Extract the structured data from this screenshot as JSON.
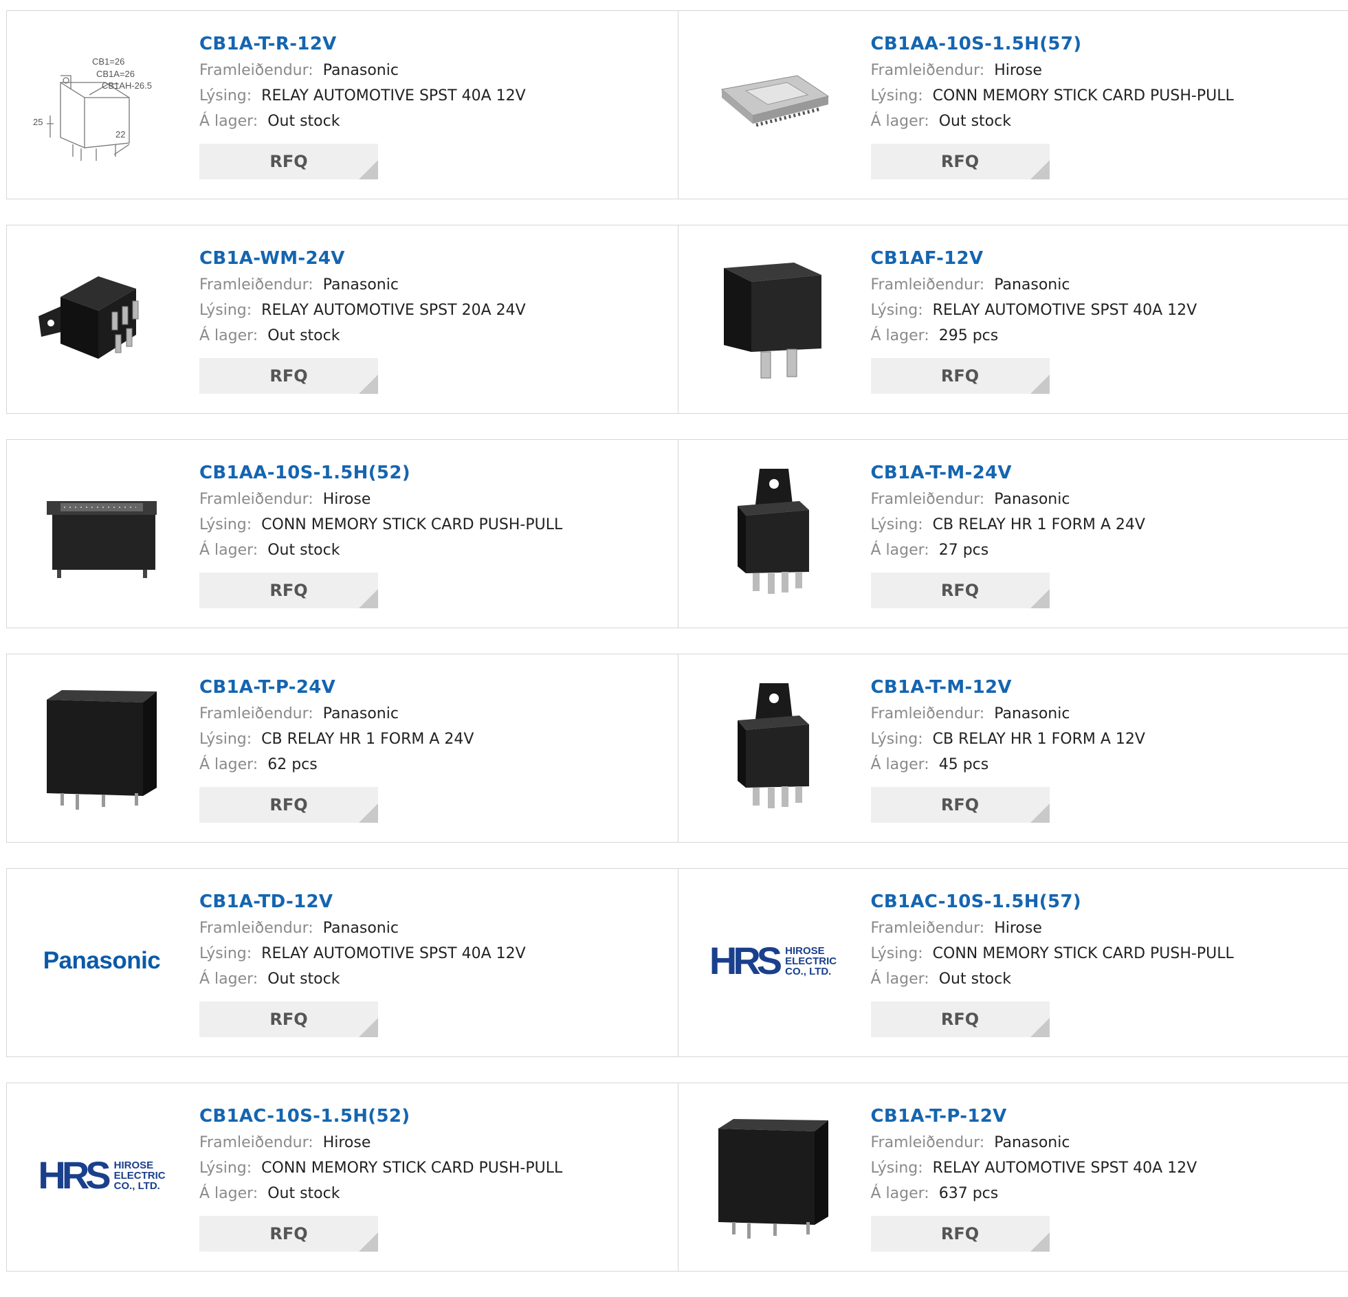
{
  "labels": {
    "manufacturer": "Framleiðendur:",
    "description": "Lýsing:",
    "stock": "Á lager:",
    "rfq": "RFQ"
  },
  "colors": {
    "title": "#1565b0",
    "border": "#d6d6d6",
    "button_bg": "#efefef"
  },
  "products": [
    {
      "part": "CB1A-T-R-12V",
      "manufacturer": "Panasonic",
      "description": "RELAY AUTOMOTIVE SPST 40A 12V",
      "stock": "Out stock",
      "image": "relay-dimension-drawing",
      "drawing_labels": [
        "CB1=26",
        "CB1A=26",
        "CB1AH-26.5",
        "25",
        "22"
      ]
    },
    {
      "part": "CB1AA-10S-1.5H(57)",
      "manufacturer": "Hirose",
      "description": "CONN MEMORY STICK CARD PUSH-PULL",
      "stock": "Out stock",
      "image": "card-connector"
    },
    {
      "part": "CB1A-WM-24V",
      "manufacturer": "Panasonic",
      "description": "RELAY AUTOMOTIVE SPST 20A 24V",
      "stock": "Out stock",
      "image": "relay-flange"
    },
    {
      "part": "CB1AF-12V",
      "manufacturer": "Panasonic",
      "description": "RELAY AUTOMOTIVE SPST 40A 12V",
      "stock": "295 pcs",
      "image": "relay-tall"
    },
    {
      "part": "CB1AA-10S-1.5H(52)",
      "manufacturer": "Hirose",
      "description": "CONN MEMORY STICK CARD PUSH-PULL",
      "stock": "Out stock",
      "image": "card-connector-dark"
    },
    {
      "part": "CB1A-T-M-24V",
      "manufacturer": "Panasonic",
      "description": "CB RELAY HR 1 FORM A 24V",
      "stock": "27 pcs",
      "image": "relay-bracket"
    },
    {
      "part": "CB1A-T-P-24V",
      "manufacturer": "Panasonic",
      "description": "CB RELAY HR 1 FORM A 24V",
      "stock": "62 pcs",
      "image": "relay-pcb"
    },
    {
      "part": "CB1A-T-M-12V",
      "manufacturer": "Panasonic",
      "description": "CB RELAY HR 1 FORM A 12V",
      "stock": "45 pcs",
      "image": "relay-bracket"
    },
    {
      "part": "CB1A-TD-12V",
      "manufacturer": "Panasonic",
      "description": "RELAY AUTOMOTIVE SPST 40A 12V",
      "stock": "Out stock",
      "image": "logo-panasonic",
      "logo_text": "Panasonic"
    },
    {
      "part": "CB1AC-10S-1.5H(57)",
      "manufacturer": "Hirose",
      "description": "CONN MEMORY STICK CARD PUSH-PULL",
      "stock": "Out stock",
      "image": "logo-hirose",
      "logo_text": "HRS",
      "logo_sub": [
        "HIROSE",
        "ELECTRIC",
        "CO., LTD."
      ]
    },
    {
      "part": "CB1AC-10S-1.5H(52)",
      "manufacturer": "Hirose",
      "description": "CONN MEMORY STICK CARD PUSH-PULL",
      "stock": "Out stock",
      "image": "logo-hirose",
      "logo_text": "HRS",
      "logo_sub": [
        "HIROSE",
        "ELECTRIC",
        "CO., LTD."
      ]
    },
    {
      "part": "CB1A-T-P-12V",
      "manufacturer": "Panasonic",
      "description": "RELAY AUTOMOTIVE SPST 40A 12V",
      "stock": "637 pcs",
      "image": "relay-pcb"
    }
  ]
}
